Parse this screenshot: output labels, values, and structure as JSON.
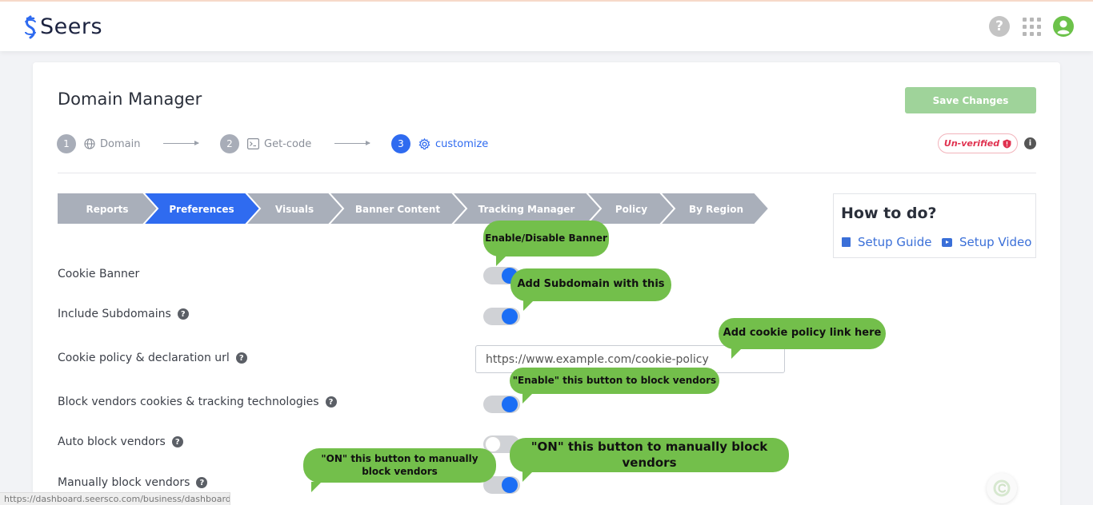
{
  "header": {
    "logo_text": "Seers",
    "help_glyph": "?",
    "icons": [
      "help-icon",
      "apps-grid-icon",
      "user-icon"
    ],
    "accent": "#6cc24a"
  },
  "page": {
    "title": "Domain Manager",
    "save_label": "Save Changes",
    "status_label": "Un-verified",
    "info_glyph": "i"
  },
  "steps": [
    {
      "num": "1",
      "label": "Domain",
      "icon": "globe-icon"
    },
    {
      "num": "2",
      "label": "Get-code",
      "icon": "terminal-icon"
    },
    {
      "num": "3",
      "label": "customize",
      "icon": "gear-icon"
    }
  ],
  "tabs": [
    {
      "label": "Reports"
    },
    {
      "label": "Preferences"
    },
    {
      "label": "Visuals"
    },
    {
      "label": "Banner Content"
    },
    {
      "label": "Tracking Manager"
    },
    {
      "label": "Policy"
    },
    {
      "label": "By Region"
    }
  ],
  "howto": {
    "title": "How to do?",
    "guide_label": "Setup Guide",
    "video_label": "Setup Video"
  },
  "settings": {
    "help_glyph": "?",
    "cookie_banner": {
      "label": "Cookie Banner",
      "on": true
    },
    "include_subdomains": {
      "label": "Include Subdomains",
      "on": true
    },
    "cookie_policy": {
      "label": "Cookie policy & declaration url",
      "value": "https://www.example.com/cookie-policy"
    },
    "block_vendors": {
      "label": "Block vendors cookies & tracking technologies",
      "on": true
    },
    "auto_block": {
      "label": "Auto block vendors",
      "on": false
    },
    "manual_block": {
      "label": "Manually block vendors",
      "on": true
    }
  },
  "callouts": {
    "enable_banner": "Enable/Disable Banner",
    "subdomain": "Add Subdomain with this",
    "policy_link": "Add cookie policy link here",
    "enable_block": "\"Enable\" this button to block vendors",
    "manual_small": "\"ON\" this button to manually block vendors",
    "manual_large": "\"ON\" this button to manually block vendors"
  },
  "status_url": "https://dashboard.seersco.com/business/dashboard",
  "colors": {
    "primary": "#2f6bf0",
    "save_button": "#9fd39a",
    "callout": "#73bf4b",
    "unverified": "#e0314f"
  }
}
